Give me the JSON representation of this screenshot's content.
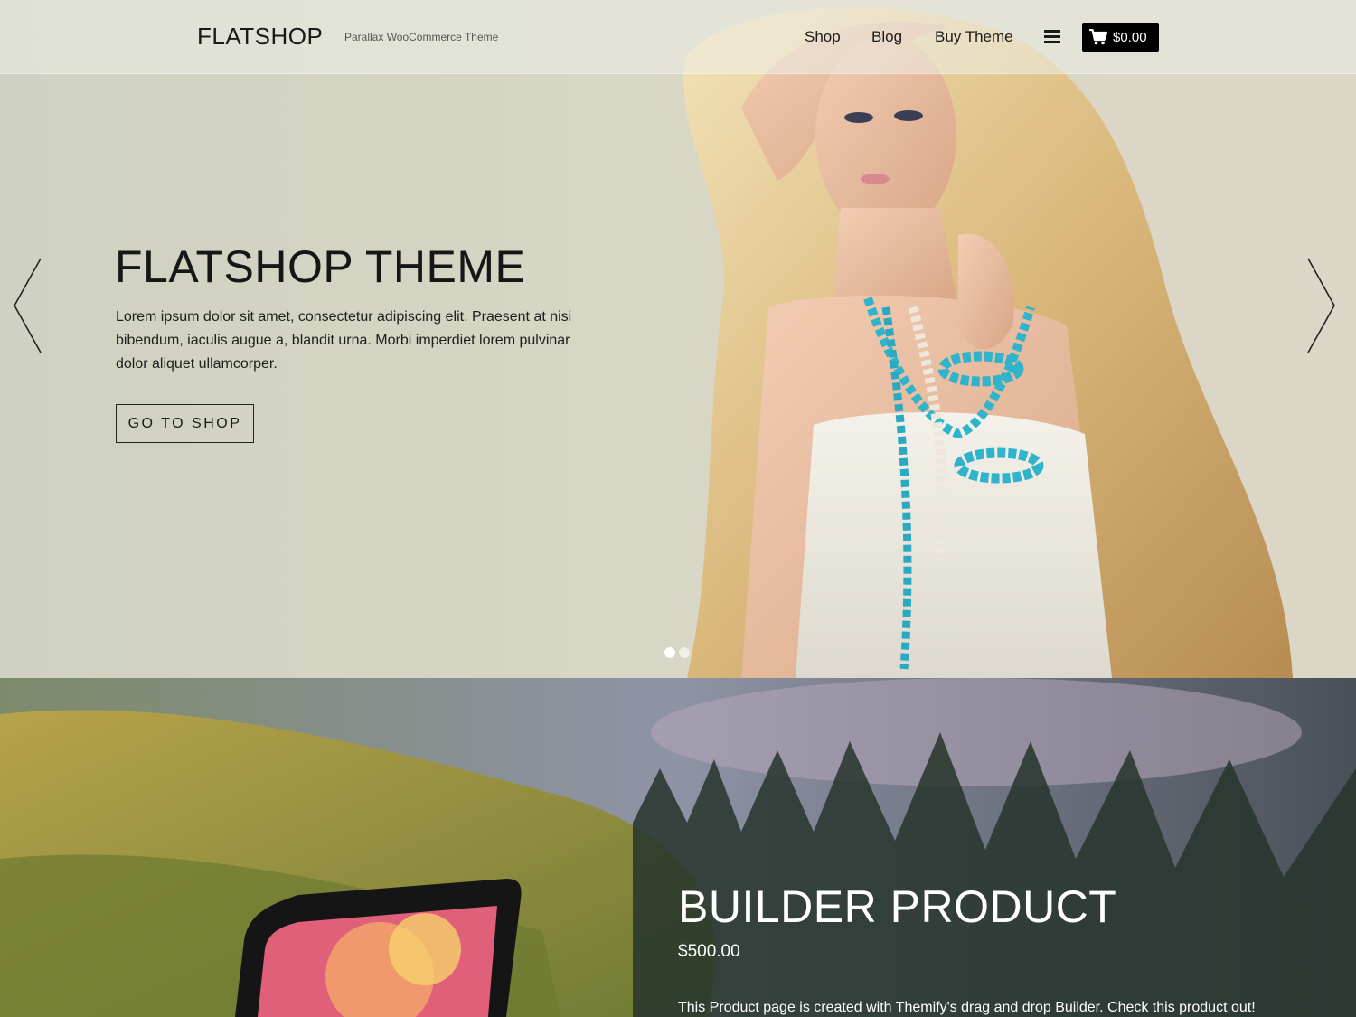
{
  "header": {
    "logo": "FLATSHOP",
    "tagline": "Parallax WooCommerce Theme",
    "nav": [
      {
        "label": "Shop"
      },
      {
        "label": "Blog"
      },
      {
        "label": "Buy Theme"
      }
    ],
    "cart_total": "$0.00"
  },
  "hero": {
    "title": "FLATSHOP THEME",
    "description": "Lorem ipsum dolor sit amet, consectetur adipiscing elit. Praesent at nisi bibendum, iaculis augue a, blandit urna. Morbi imperdiet lorem pulvinar dolor aliquet ullamcorper.",
    "button_label": "GO TO SHOP",
    "slide_count": 2,
    "active_slide": 1
  },
  "product": {
    "title": "BUILDER PRODUCT",
    "price": "$500.00",
    "description": "This Product page is created with Themify's drag and drop Builder. Check this product out!"
  },
  "icons": {
    "menu": "hamburger-icon",
    "cart": "shopping-cart-icon",
    "prev": "chevron-left-icon",
    "next": "chevron-right-icon"
  },
  "colors": {
    "cart_bg": "#000000",
    "text_dark": "#1a1a1a",
    "text_light": "#ffffff"
  }
}
